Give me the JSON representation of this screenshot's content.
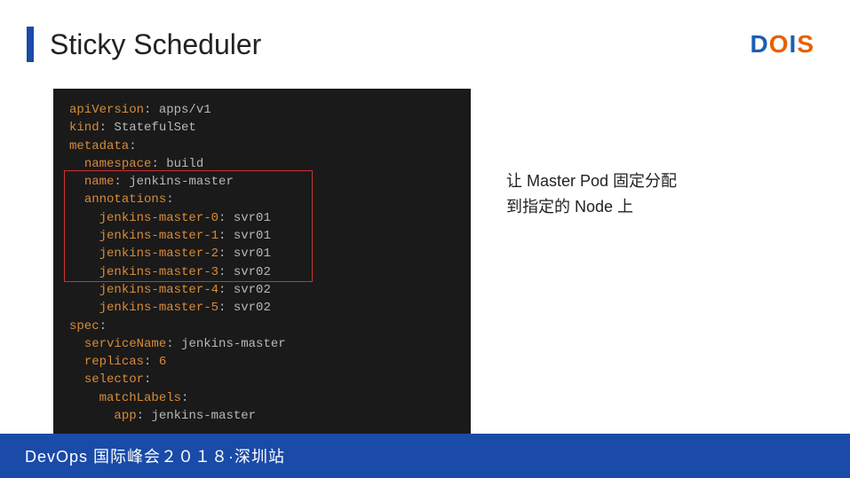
{
  "header": {
    "title": "Sticky Scheduler",
    "logo_letters": {
      "d": "D",
      "o": "O",
      "i": "I",
      "s": "S"
    }
  },
  "code": {
    "lines": [
      {
        "indent": 0,
        "key": "apiVersion",
        "val": "apps/v1"
      },
      {
        "indent": 0,
        "key": "kind",
        "val": "StatefulSet"
      },
      {
        "indent": 0,
        "key": "metadata",
        "val": ""
      },
      {
        "indent": 1,
        "key": "namespace",
        "val": "build"
      },
      {
        "indent": 1,
        "key": "name",
        "val": "jenkins-master"
      },
      {
        "indent": 1,
        "key": "annotations",
        "val": ""
      },
      {
        "indent": 2,
        "key": "jenkins-master-0",
        "val": "svr01"
      },
      {
        "indent": 2,
        "key": "jenkins-master-1",
        "val": "svr01"
      },
      {
        "indent": 2,
        "key": "jenkins-master-2",
        "val": "svr01"
      },
      {
        "indent": 2,
        "key": "jenkins-master-3",
        "val": "svr02"
      },
      {
        "indent": 2,
        "key": "jenkins-master-4",
        "val": "svr02"
      },
      {
        "indent": 2,
        "key": "jenkins-master-5",
        "val": "svr02"
      },
      {
        "indent": 0,
        "key": "spec",
        "val": ""
      },
      {
        "indent": 1,
        "key": "serviceName",
        "val": "jenkins-master"
      },
      {
        "indent": 1,
        "key": "replicas",
        "val": "6",
        "num": true
      },
      {
        "indent": 1,
        "key": "selector",
        "val": ""
      },
      {
        "indent": 2,
        "key": "matchLabels",
        "val": ""
      },
      {
        "indent": 3,
        "key": "app",
        "val": "jenkins-master"
      }
    ]
  },
  "description": {
    "line1": "让 Master Pod 固定分配",
    "line2": "到指定的 Node 上"
  },
  "footer": {
    "text": "DevOps 国际峰会２０１８·深圳站"
  }
}
